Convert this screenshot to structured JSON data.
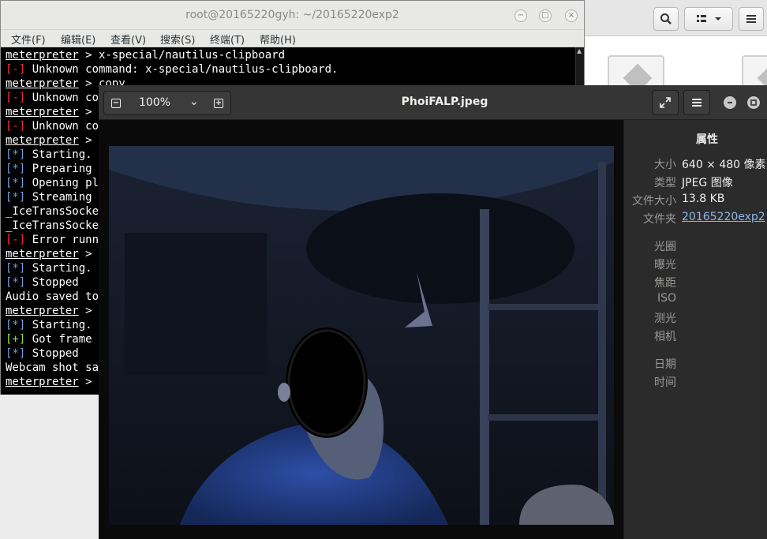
{
  "file_manager": {
    "search_icon": "search-icon",
    "view_icon": "list-view-icon",
    "menu_icon": "hamburger-menu-icon"
  },
  "terminal": {
    "title": "root@20165220gyh: ~/20165220exp2",
    "menu": [
      "文件(F)",
      "编辑(E)",
      "查看(V)",
      "搜索(S)",
      "终端(T)",
      "帮助(H)"
    ],
    "lines": [
      {
        "prompt": "meterpreter",
        "text": " > x-special/nautilus-clipboard"
      },
      {
        "tag": "[-]",
        "text": " Unknown command: x-special/nautilus-clipboard."
      },
      {
        "prompt": "meterpreter",
        "text": " > copy"
      },
      {
        "tag": "[-]",
        "text": " Unknown co"
      },
      {
        "prompt": "meterpreter",
        "text": " >"
      },
      {
        "tag": "[-]",
        "text": " Unknown co"
      },
      {
        "prompt": "meterpreter",
        "text": " >"
      },
      {
        "tag": "[*]",
        "text": " Starting."
      },
      {
        "tag": "[*]",
        "text": " Preparing"
      },
      {
        "tag": "[*]",
        "text": " Opening pl"
      },
      {
        "tag": "[*]",
        "text": " Streaming"
      },
      {
        "text": "_IceTransSocke"
      },
      {
        "text": "_IceTransSocke"
      },
      {
        "tag": "[-]",
        "text": " Error runn"
      },
      {
        "prompt": "meterpreter",
        "text": " >"
      },
      {
        "tag": "[*]",
        "text": " Starting."
      },
      {
        "tag": "[*]",
        "text": " Stopped"
      },
      {
        "text": "Audio saved to"
      },
      {
        "prompt": "meterpreter",
        "text": " >"
      },
      {
        "tag": "[*]",
        "text": " Starting."
      },
      {
        "tag": "[+]",
        "text": " Got frame"
      },
      {
        "tag": "[*]",
        "text": " Stopped"
      },
      {
        "text": "Webcam shot sa"
      },
      {
        "prompt": "meterpreter",
        "text": " >"
      }
    ]
  },
  "viewer": {
    "zoom": "100%",
    "title": "PhoiFALP.jpeg",
    "props_heading": "属性",
    "props": [
      {
        "label": "大小",
        "value": "640 × 480 像素"
      },
      {
        "label": "类型",
        "value": "JPEG 图像"
      },
      {
        "label": "文件大小",
        "value": "13.8 KB"
      },
      {
        "label": "文件夹",
        "value": "20165220exp2",
        "link": true
      }
    ],
    "exif": [
      "光圈",
      "曝光",
      "焦距",
      "ISO",
      "测光",
      "相机"
    ],
    "dates": [
      "日期",
      "时间"
    ]
  },
  "colors": {
    "term_red": "#ef2929",
    "term_blue": "#6f9fe0",
    "term_green": "#8ae234",
    "link": "#8fb6e8"
  }
}
